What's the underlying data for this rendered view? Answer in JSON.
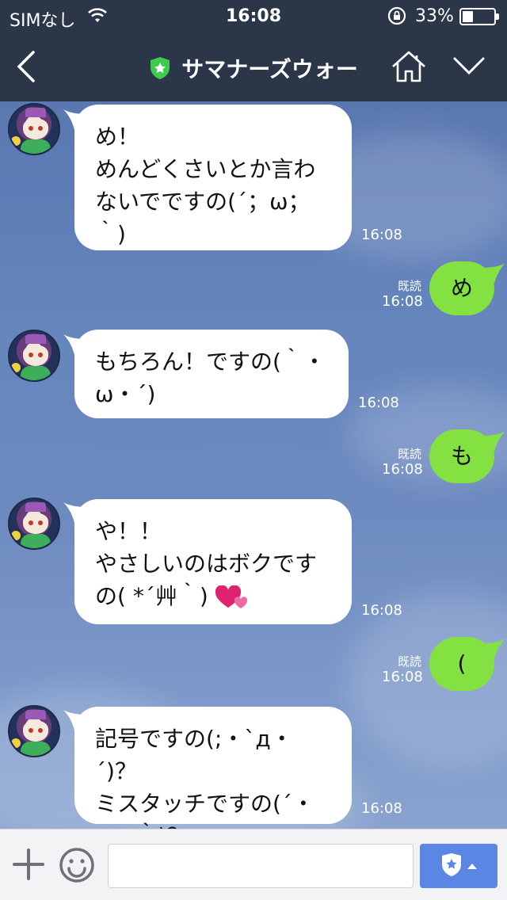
{
  "status_bar": {
    "carrier": "SIMなし",
    "time": "16:08",
    "battery_percent": "33%",
    "battery_level": 0.33
  },
  "nav": {
    "title": "サマナーズウォー"
  },
  "messages": [
    {
      "direction": "in",
      "lines": [
        "め！",
        "めんどくさいとか言わ",
        "ないでですの(´；ω；",
        "｀)"
      ],
      "time": "16:08"
    },
    {
      "direction": "out",
      "text": "め",
      "read": "既読",
      "time": "16:08"
    },
    {
      "direction": "in",
      "lines": [
        "もちろん！ですの(｀・",
        "ω・´)"
      ],
      "time": "16:08"
    },
    {
      "direction": "out",
      "text": "も",
      "read": "既読",
      "time": "16:08"
    },
    {
      "direction": "in",
      "lines": [
        "や！！",
        "やさしいのはボクです",
        "の( *´艸｀)"
      ],
      "emoji": "heart-emoji",
      "time": "16:08"
    },
    {
      "direction": "out",
      "text": "(",
      "read": "既読",
      "time": "16:08"
    },
    {
      "direction": "in",
      "lines": [
        "記号ですの(;・`д・´)？",
        "ミスタッチですの(´・",
        "ω・｀)？"
      ],
      "time": "16:08"
    }
  ],
  "input": {
    "placeholder": ""
  },
  "colors": {
    "header_bg": "#2c3649",
    "outgoing_bubble": "#84e142",
    "incoming_bubble": "#ffffff",
    "sticker_button": "#5a86e4",
    "official_badge": "#3ecb4f"
  }
}
